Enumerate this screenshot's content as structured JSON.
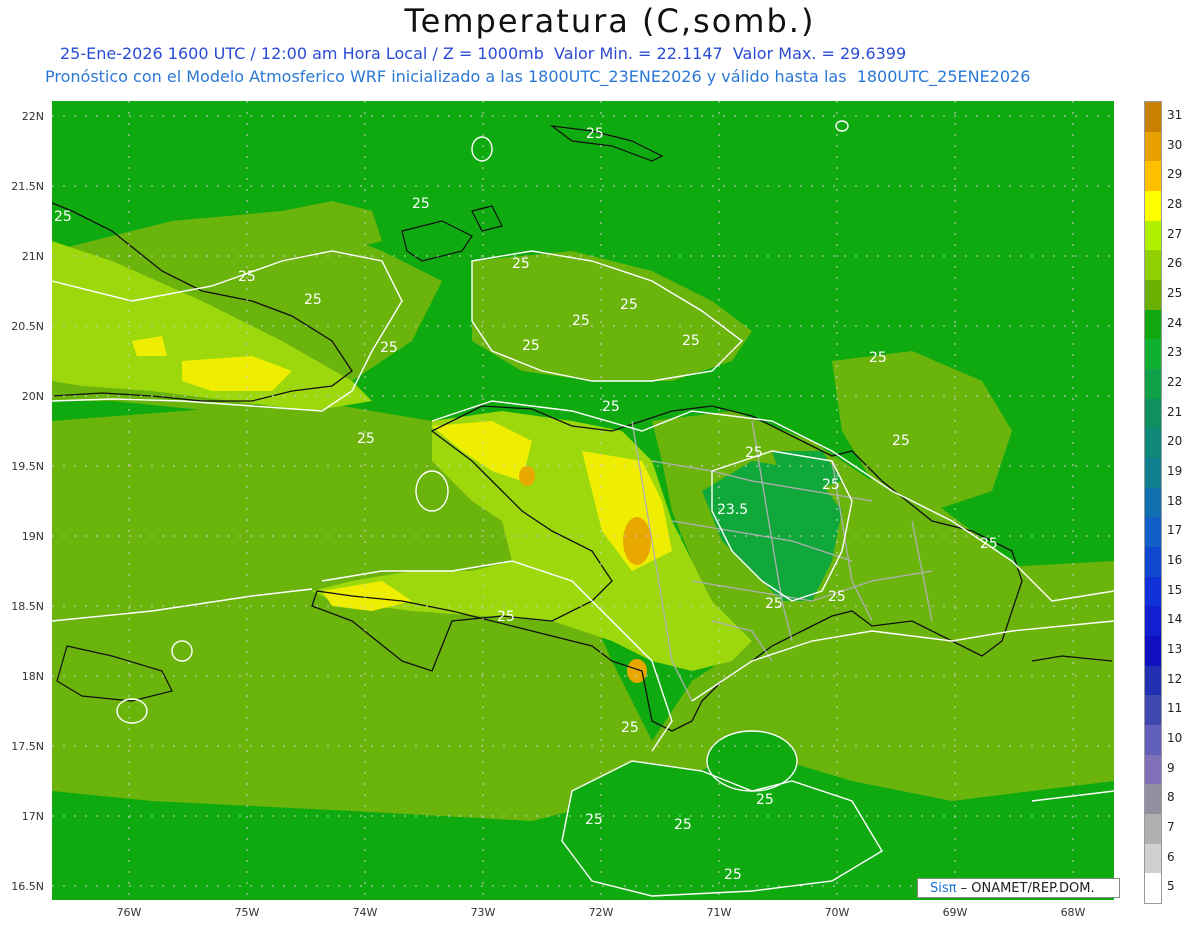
{
  "header": {
    "title": "Temperatura (C,somb.)",
    "line1": "25-Ene-2026 1600 UTC / 12:00 am Hora Local / Z = 1000mb  Valor Min. = 22.1147  Valor Max. = 29.6399",
    "line2": "Pronóstico con el Modelo Atmosferico WRF inicializado a las 1800UTC_23ENE2026 y válido hasta las  1800UTC_25ENE2026"
  },
  "map": {
    "lat_labels": [
      "22N",
      "21.5N",
      "21N",
      "20.5N",
      "20N",
      "19.5N",
      "19N",
      "18.5N",
      "18N",
      "17.5N",
      "17N",
      "16.5N"
    ],
    "lon_labels": [
      "76W",
      "75W",
      "74W",
      "73W",
      "72W",
      "71W",
      "70W",
      "69W",
      "68W"
    ],
    "contour_labels": [
      "25",
      "25",
      "25",
      "25",
      "25",
      "25",
      "25",
      "25",
      "25",
      "25",
      "25",
      "25",
      "25",
      "25",
      "25",
      "25",
      "25",
      "25",
      "25",
      "25",
      "23.5",
      "25",
      "25",
      "25",
      "25",
      "25",
      "25"
    ],
    "colors": {
      "sea": "#0faa0f",
      "warm_sea": "#6ab40c",
      "land_warm": "#9cd80c",
      "land_hot": "#f0ee00",
      "peak": "#e8a800",
      "cool": "#10a83a"
    }
  },
  "colorbar": {
    "levels": [
      "31",
      "30",
      "29",
      "28",
      "27",
      "26",
      "25",
      "24",
      "23",
      "22",
      "21",
      "20",
      "19",
      "18",
      "17",
      "16",
      "15",
      "14",
      "13",
      "12",
      "11",
      "10",
      "9",
      "8",
      "7",
      "6",
      "5"
    ],
    "colors": [
      "#c88000",
      "#e8a000",
      "#ffc000",
      "#ffff00",
      "#b0f000",
      "#90d000",
      "#6ab000",
      "#10a810",
      "#10b030",
      "#10a048",
      "#109060",
      "#108878",
      "#108090",
      "#1070b0",
      "#1060c8",
      "#1048d0",
      "#1030d8",
      "#1020d0",
      "#1010c0",
      "#2030b0",
      "#4048b0",
      "#6060b8",
      "#8070b8",
      "#9090a0",
      "#b0b0b0",
      "#d0d0d0",
      "#ffffff"
    ]
  },
  "credit": {
    "brand": "Sisπ",
    "text": "– ONAMET/REP.DOM."
  }
}
